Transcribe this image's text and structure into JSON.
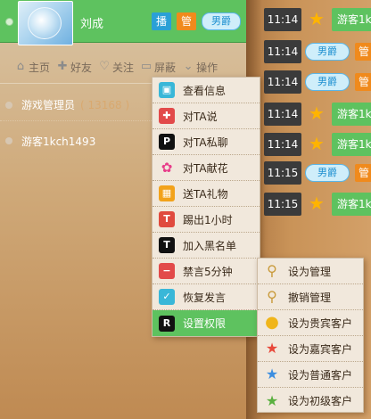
{
  "user_header": {
    "name": "刘成",
    "tags": [
      "播",
      "管",
      "男爵"
    ]
  },
  "actions": [
    {
      "icon": "home-icon",
      "label": "主页"
    },
    {
      "icon": "add-friend-icon",
      "label": "好友"
    },
    {
      "icon": "heart-icon",
      "label": "关注"
    },
    {
      "icon": "block-icon",
      "label": "屏蔽"
    },
    {
      "icon": "operate-icon",
      "label": "操作"
    }
  ],
  "user_list": [
    {
      "name": "游戏管理员",
      "count": "( 13168 )"
    },
    {
      "name": "游客1kch1493",
      "count": ""
    }
  ],
  "chat": [
    {
      "time": "11:14",
      "kind": "guest",
      "text": "游客1k"
    },
    {
      "time": "11:14",
      "kind": "nanjue",
      "tag": "男爵",
      "guan": "管"
    },
    {
      "time": "11:14",
      "kind": "nanjue",
      "tag": "男爵",
      "guan": "管"
    },
    {
      "time": "11:14",
      "kind": "guest",
      "text": "游客1k"
    },
    {
      "time": "11:14",
      "kind": "guest",
      "text": "游客1k"
    },
    {
      "time": "11:15",
      "kind": "nanjue",
      "tag": "男爵",
      "guan": "管"
    },
    {
      "time": "11:15",
      "kind": "guest",
      "text": "游客1k"
    }
  ],
  "context_menu": [
    {
      "label": "查看信息",
      "icon": "shirt-icon",
      "color": "#39b7d8"
    },
    {
      "label": "对TA说",
      "icon": "plus-icon",
      "color": "#e24a4a"
    },
    {
      "label": "对TA私聊",
      "icon": "p-icon",
      "color": "#111111"
    },
    {
      "label": "对TA献花",
      "icon": "flower-icon",
      "color": "#f2f2f2"
    },
    {
      "label": "送TA礼物",
      "icon": "gift-icon",
      "color": "#f2a21a"
    },
    {
      "label": "踢出1小时",
      "icon": "t-red-icon",
      "color": "#e04a3e"
    },
    {
      "label": "加入黑名单",
      "icon": "t-black-icon",
      "color": "#111111"
    },
    {
      "label": "禁言5分钟",
      "icon": "minus-icon",
      "color": "#e24a4a"
    },
    {
      "label": "恢复发言",
      "icon": "check-icon",
      "color": "#39b7d8"
    },
    {
      "label": "设置权限",
      "icon": "r-icon",
      "color": "#111111"
    }
  ],
  "sub_menu": [
    {
      "label": "设为管理",
      "icon": "key-add-icon"
    },
    {
      "label": "撤销管理",
      "icon": "key-remove-icon"
    },
    {
      "label": "设为贵宾客户",
      "icon": "gold-coin-icon"
    },
    {
      "label": "设为嘉宾客户",
      "icon": "red-star-icon"
    },
    {
      "label": "设为普通客户",
      "icon": "blue-star-icon"
    },
    {
      "label": "设为初级客户",
      "icon": "green-star-icon"
    }
  ]
}
